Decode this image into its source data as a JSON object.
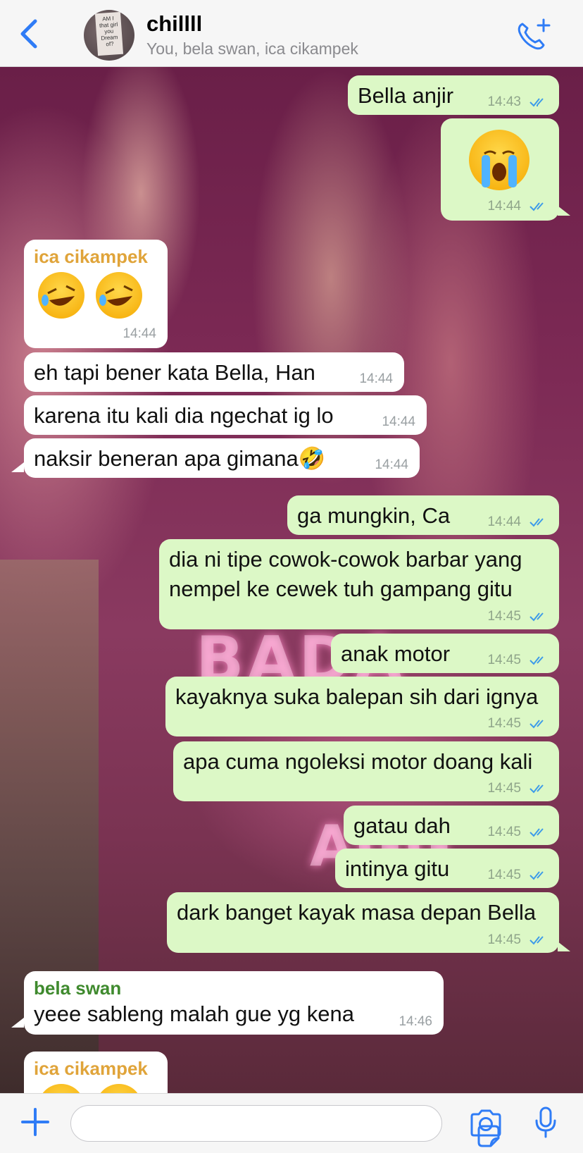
{
  "header": {
    "title": "chillll",
    "participants": "You, bela swan, ica cikampek",
    "avatar_text": "AM I that girl you Dream of?"
  },
  "messages": [
    {
      "dir": "out",
      "text": "Bella anjir",
      "time": "14:43",
      "read": true
    },
    {
      "dir": "out",
      "emoji": "loudly-crying-face",
      "time": "14:44",
      "read": true
    },
    {
      "dir": "in",
      "sender": "ica cikampek",
      "emoji": "rolling-on-floor-laughing x2",
      "time": "14:44"
    },
    {
      "dir": "in",
      "text": "eh tapi bener kata Bella, Han",
      "time": "14:44"
    },
    {
      "dir": "in",
      "text": "karena itu kali dia ngechat ig lo",
      "time": "14:44"
    },
    {
      "dir": "in",
      "text": "naksir beneran apa gimana🤣",
      "time": "14:44"
    },
    {
      "dir": "out",
      "text": "ga mungkin, Ca",
      "time": "14:44",
      "read": true
    },
    {
      "dir": "out",
      "text_line1": "dia ni tipe cowok-cowok barbar yang",
      "text_line2": "nempel ke cewek tuh gampang gitu",
      "time": "14:45",
      "read": true
    },
    {
      "dir": "out",
      "text": "anak motor",
      "time": "14:45",
      "read": true
    },
    {
      "dir": "out",
      "text": "kayaknya suka balepan sih dari ignya",
      "time": "14:45",
      "read": true
    },
    {
      "dir": "out",
      "text": "apa cuma ngoleksi motor doang kali",
      "time": "14:45",
      "read": true
    },
    {
      "dir": "out",
      "text": "gatau dah",
      "time": "14:45",
      "read": true
    },
    {
      "dir": "out",
      "text": "intinya gitu",
      "time": "14:45",
      "read": true
    },
    {
      "dir": "out",
      "text": "dark banget kayak masa depan Bella",
      "time": "14:45",
      "read": true
    },
    {
      "dir": "in",
      "sender": "bela swan",
      "text": "yeee sableng malah gue yg kena",
      "time": "14:46"
    },
    {
      "dir": "in",
      "sender": "ica cikampek",
      "emoji": "rolling-on-floor-laughing",
      "time": ""
    }
  ],
  "composer": {
    "value": "",
    "placeholder": ""
  },
  "icons": {
    "back": "chevron-left-icon",
    "call": "add-call-icon",
    "plus": "plus-icon",
    "sticker": "sticker-icon",
    "camera": "camera-icon",
    "mic": "microphone-icon"
  },
  "colors": {
    "accent": "#2f7cf6",
    "outgoing_bubble": "#dcf8c6",
    "incoming_bubble": "#ffffff",
    "sender_ica": "#e0a43a",
    "sender_bela": "#3f8a2e"
  }
}
